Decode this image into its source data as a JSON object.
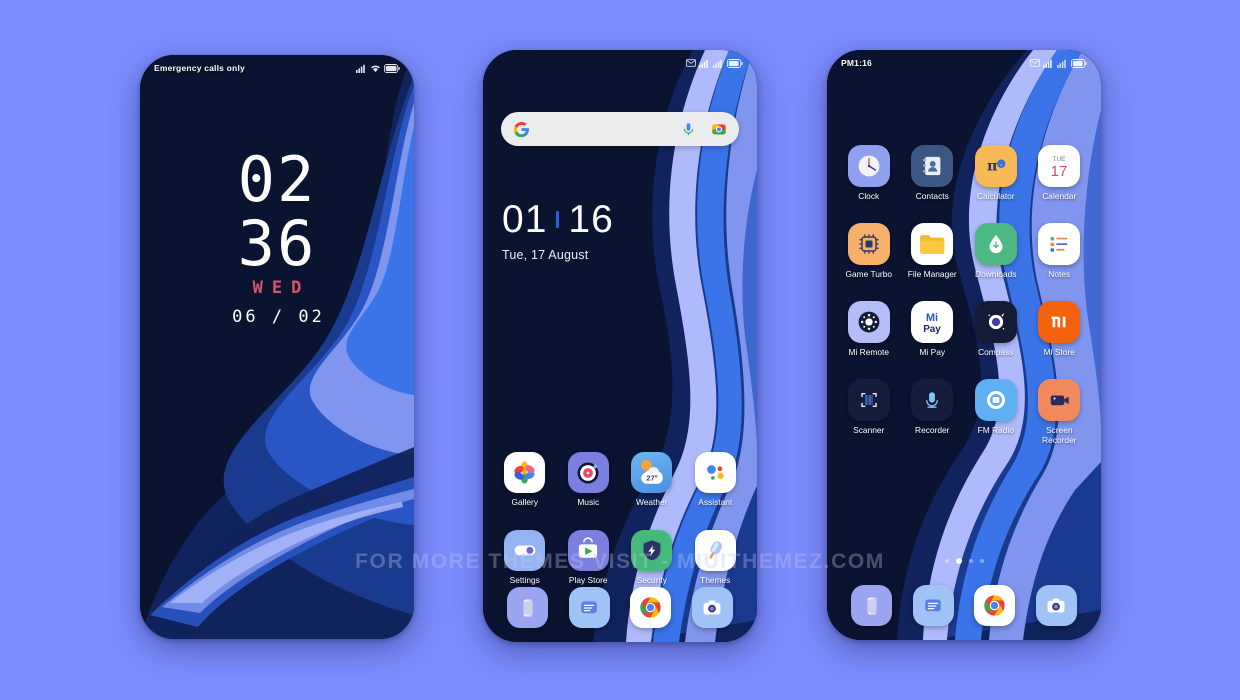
{
  "page": {
    "background_color": "#7b8cfc",
    "watermark": "FOR MORE THEMES VISIT - MIUITHEMEZ.COM"
  },
  "phone1": {
    "statusbar": {
      "carrier": "Emergency calls only",
      "icons": [
        "signal-icon",
        "wifi-icon",
        "battery-icon"
      ]
    },
    "lockscreen": {
      "hours": "02",
      "minutes": "36",
      "weekday": "WED",
      "date": "06 / 02",
      "weekday_color": "#d9536b"
    }
  },
  "phone2": {
    "statusbar": {
      "time": "",
      "icons": [
        "mail-icon",
        "signal-icon",
        "signal-icon",
        "battery-icon"
      ]
    },
    "search": {
      "placeholder": "",
      "icons": [
        "google-g-icon",
        "mic-icon",
        "lens-camera-icon"
      ]
    },
    "clock": {
      "hours": "01",
      "minutes": "16",
      "date": "Tue, 17 August"
    },
    "apps": [
      [
        {
          "label": "Gallery",
          "icon": "gallery-icon"
        },
        {
          "label": "Music",
          "icon": "music-icon"
        },
        {
          "label": "Weather",
          "icon": "weather-icon",
          "badge": "27°"
        },
        {
          "label": "Assistant",
          "icon": "assistant-icon"
        }
      ],
      [
        {
          "label": "Settings",
          "icon": "settings-icon"
        },
        {
          "label": "Play Store",
          "icon": "play-store-icon"
        },
        {
          "label": "Security",
          "icon": "security-icon"
        },
        {
          "label": "Themes",
          "icon": "themes-icon"
        }
      ]
    ],
    "dock": [
      {
        "label": "Phone",
        "icon": "phone-icon"
      },
      {
        "label": "Messages",
        "icon": "messages-icon"
      },
      {
        "label": "Chrome",
        "icon": "chrome-icon"
      },
      {
        "label": "Camera",
        "icon": "camera-icon"
      }
    ]
  },
  "phone3": {
    "statusbar": {
      "time": "PM1:16",
      "icons": [
        "mail-icon",
        "signal-icon",
        "signal-icon",
        "battery-icon"
      ]
    },
    "apps": [
      [
        {
          "label": "Clock",
          "icon": "clock-icon"
        },
        {
          "label": "Contacts",
          "icon": "contacts-icon"
        },
        {
          "label": "Calculator",
          "icon": "calculator-icon"
        },
        {
          "label": "Calendar",
          "icon": "calendar-icon",
          "day_name": "TUE",
          "day_number": "17"
        }
      ],
      [
        {
          "label": "Game Turbo",
          "icon": "game-turbo-icon"
        },
        {
          "label": "File Manager",
          "icon": "file-manager-icon"
        },
        {
          "label": "Downloads",
          "icon": "downloads-icon"
        },
        {
          "label": "Notes",
          "icon": "notes-icon"
        }
      ],
      [
        {
          "label": "Mi Remote",
          "icon": "mi-remote-icon"
        },
        {
          "label": "Mi Pay",
          "icon": "mi-pay-icon"
        },
        {
          "label": "Compass",
          "icon": "compass-icon"
        },
        {
          "label": "Mi Store",
          "icon": "mi-store-icon"
        }
      ],
      [
        {
          "label": "Scanner",
          "icon": "scanner-icon"
        },
        {
          "label": "Recorder",
          "icon": "recorder-icon"
        },
        {
          "label": "FM Radio",
          "icon": "fm-radio-icon"
        },
        {
          "label": "Screen Recorder",
          "icon": "screen-recorder-icon"
        }
      ]
    ],
    "pages": {
      "count": 4,
      "active": 1
    },
    "dock": [
      {
        "label": "Phone",
        "icon": "phone-icon"
      },
      {
        "label": "Messages",
        "icon": "messages-icon"
      },
      {
        "label": "Chrome",
        "icon": "chrome-icon"
      },
      {
        "label": "Camera",
        "icon": "camera-icon"
      }
    ]
  }
}
